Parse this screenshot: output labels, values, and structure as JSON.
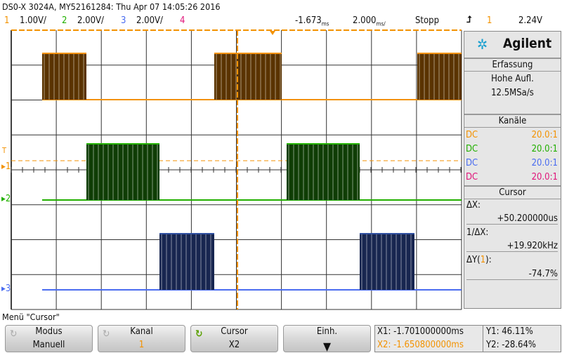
{
  "header": {
    "title": "DS0-X 3024A, MY52161284: Thu Apr 07 14:05:26 2016",
    "channels": [
      {
        "num": "1",
        "scale": "1.00V/",
        "color": "#f39200"
      },
      {
        "num": "2",
        "scale": "2.00V/",
        "color": "#22b000"
      },
      {
        "num": "3",
        "scale": "2.00V/",
        "color": "#4a6cf0"
      },
      {
        "num": "4",
        "scale": "",
        "color": "#e0157a"
      }
    ],
    "delay": "-1.673",
    "delay_unit": "ms",
    "timebase": "2.000",
    "timebase_unit": "ms/",
    "run_state": "Stopp",
    "trigger_icon": "rising-edge-icon",
    "trigger_source": "1",
    "trigger_level": "2.24V"
  },
  "markers": {
    "trigger": "T",
    "ch1": "1",
    "ch2": "2",
    "ch3": "3"
  },
  "panel": {
    "brand": "Agilent",
    "acq_title": "Erfassung",
    "acq_mode": "Hohe Aufl.",
    "sample_rate": "12.5MSa/s",
    "channels_title": "Kanäle",
    "channel_rows": [
      {
        "coupling": "DC",
        "probe": "20.0:1",
        "color": "#f39200"
      },
      {
        "coupling": "DC",
        "probe": "20.0:1",
        "color": "#22b000"
      },
      {
        "coupling": "DC",
        "probe": "20.0:1",
        "color": "#4a6cf0"
      },
      {
        "coupling": "DC",
        "probe": "20.0:1",
        "color": "#e0157a"
      }
    ],
    "cursor_title": "Cursor",
    "dx_label": "ΔX:",
    "dx": "+50.200000us",
    "inv_dx_label": "1/ΔX:",
    "inv_dx": "+19.920kHz",
    "dy_label_pre": "ΔY(",
    "dy_ch": "1",
    "dy_label_post": "):",
    "dy": "-74.7%"
  },
  "menu": {
    "title": "Menü \"Cursor\"",
    "buttons": [
      {
        "top": "Modus",
        "bottom": "Manuell"
      },
      {
        "top": "Kanal",
        "bottom": "1"
      },
      {
        "top": "Cursor",
        "bottom": "X2"
      },
      {
        "top": "Einh.",
        "bottom": ""
      }
    ],
    "x1": "X1: -1.701000000ms",
    "x2": "X2: -1.650800000ms",
    "y1": "Y1: 46.11%",
    "y2": "Y2: -28.64%"
  }
}
